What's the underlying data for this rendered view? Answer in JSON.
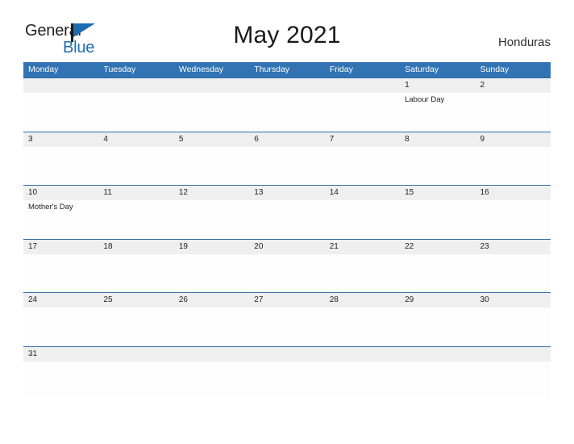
{
  "brand": {
    "logo_word1": "General",
    "logo_word2": "Blue",
    "logo_icon": "blue-flag-triangle",
    "color_primary": "#1f6cb0"
  },
  "header": {
    "title": "May 2021",
    "country": "Honduras"
  },
  "theme": {
    "header_blue": "#3173b3",
    "rule_blue": "#2e6da4",
    "date_band_gray": "#efefef",
    "text_dark": "#1f1f1f"
  },
  "calendar": {
    "month": "May",
    "year": "2021",
    "weekdays": [
      "Monday",
      "Tuesday",
      "Wednesday",
      "Thursday",
      "Friday",
      "Saturday",
      "Sunday"
    ],
    "weeks": [
      {
        "days": [
          {
            "date": "",
            "event": ""
          },
          {
            "date": "",
            "event": ""
          },
          {
            "date": "",
            "event": ""
          },
          {
            "date": "",
            "event": ""
          },
          {
            "date": "",
            "event": ""
          },
          {
            "date": "1",
            "event": "Labour Day"
          },
          {
            "date": "2",
            "event": ""
          }
        ]
      },
      {
        "days": [
          {
            "date": "3",
            "event": ""
          },
          {
            "date": "4",
            "event": ""
          },
          {
            "date": "5",
            "event": ""
          },
          {
            "date": "6",
            "event": ""
          },
          {
            "date": "7",
            "event": ""
          },
          {
            "date": "8",
            "event": ""
          },
          {
            "date": "9",
            "event": ""
          }
        ]
      },
      {
        "days": [
          {
            "date": "10",
            "event": "Mother's Day"
          },
          {
            "date": "11",
            "event": ""
          },
          {
            "date": "12",
            "event": ""
          },
          {
            "date": "13",
            "event": ""
          },
          {
            "date": "14",
            "event": ""
          },
          {
            "date": "15",
            "event": ""
          },
          {
            "date": "16",
            "event": ""
          }
        ]
      },
      {
        "days": [
          {
            "date": "17",
            "event": ""
          },
          {
            "date": "18",
            "event": ""
          },
          {
            "date": "19",
            "event": ""
          },
          {
            "date": "20",
            "event": ""
          },
          {
            "date": "21",
            "event": ""
          },
          {
            "date": "22",
            "event": ""
          },
          {
            "date": "23",
            "event": ""
          }
        ]
      },
      {
        "days": [
          {
            "date": "24",
            "event": ""
          },
          {
            "date": "25",
            "event": ""
          },
          {
            "date": "26",
            "event": ""
          },
          {
            "date": "27",
            "event": ""
          },
          {
            "date": "28",
            "event": ""
          },
          {
            "date": "29",
            "event": ""
          },
          {
            "date": "30",
            "event": ""
          }
        ]
      },
      {
        "days": [
          {
            "date": "31",
            "event": ""
          },
          {
            "date": "",
            "event": ""
          },
          {
            "date": "",
            "event": ""
          },
          {
            "date": "",
            "event": ""
          },
          {
            "date": "",
            "event": ""
          },
          {
            "date": "",
            "event": ""
          },
          {
            "date": "",
            "event": ""
          }
        ]
      }
    ]
  }
}
